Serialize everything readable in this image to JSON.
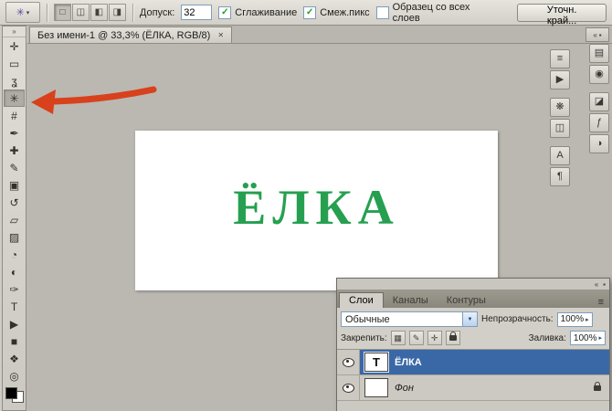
{
  "colors": {
    "artwork_green": "#26a050",
    "arrow_red": "#d8411c",
    "selected_layer_blue": "#3a68a6"
  },
  "icons": {
    "close": "✕",
    "chevron_left": "«",
    "chevron_right": "»",
    "caret_down": "▾",
    "dropdown_arrow": "▼",
    "spinner_arrow": "▸",
    "check": "✓",
    "menu": "≡",
    "panel_box": "▪"
  },
  "options_bar": {
    "tool_preset_icon": "✳",
    "selection_modes": [
      {
        "name": "new-selection",
        "glyph": "□"
      },
      {
        "name": "add-to-selection",
        "glyph": "◫"
      },
      {
        "name": "subtract-from-selection",
        "glyph": "◧"
      },
      {
        "name": "intersect-selection",
        "glyph": "◨"
      }
    ],
    "tolerance_label": "Допуск:",
    "tolerance_value": "32",
    "checkboxes": [
      {
        "label": "Сглаживание",
        "checked": true
      },
      {
        "label": "Смеж.пикс",
        "checked": true
      },
      {
        "label": "Образец со всех слоев",
        "checked": false
      }
    ],
    "refine_edge_button": "Уточн. край..."
  },
  "tab_bar": {
    "document_title": "Без имени-1 @ 33,3% (ЁЛКА, RGB/8)"
  },
  "toolbar": {
    "tools": [
      {
        "name": "move",
        "glyph": "✛"
      },
      {
        "name": "rectangular-marquee",
        "glyph": "▭"
      },
      {
        "name": "lasso",
        "glyph": "ʓ"
      },
      {
        "name": "magic-wand",
        "glyph": "✳",
        "active": true
      },
      {
        "name": "crop",
        "glyph": "#"
      },
      {
        "name": "eyedropper",
        "glyph": "✒"
      },
      {
        "name": "healing-brush",
        "glyph": "✚"
      },
      {
        "name": "brush",
        "glyph": "✎"
      },
      {
        "name": "clone-stamp",
        "glyph": "▣"
      },
      {
        "name": "history-brush",
        "glyph": "↺"
      },
      {
        "name": "eraser",
        "glyph": "▱"
      },
      {
        "name": "gradient",
        "glyph": "▨"
      },
      {
        "name": "blur",
        "glyph": "◔"
      },
      {
        "name": "dodge",
        "glyph": "◐"
      },
      {
        "name": "pen",
        "glyph": "✑"
      },
      {
        "name": "type",
        "glyph": "T"
      },
      {
        "name": "path-selection",
        "glyph": "▶"
      },
      {
        "name": "shape",
        "glyph": "■"
      },
      {
        "name": "hand",
        "glyph": "❖"
      },
      {
        "name": "zoom",
        "glyph": "◎"
      }
    ]
  },
  "canvas": {
    "artwork_text": "ЁЛКА"
  },
  "right_dock": {
    "inner_column": [
      {
        "name": "adjustments",
        "glyph": "≡"
      },
      {
        "name": "actions",
        "glyph": "▶"
      },
      {
        "name": "brushes",
        "glyph": "❋"
      },
      {
        "name": "clone-source",
        "glyph": "◫"
      },
      {
        "name": "character",
        "glyph": "A"
      },
      {
        "name": "paragraph",
        "glyph": "¶"
      }
    ],
    "outer_column": [
      {
        "name": "histogram",
        "glyph": "▤"
      },
      {
        "name": "navigator",
        "glyph": "◉"
      },
      {
        "name": "color",
        "glyph": "◪"
      },
      {
        "name": "styles",
        "glyph": "ƒ"
      },
      {
        "name": "masks",
        "glyph": "◑"
      }
    ]
  },
  "layers_panel": {
    "tabs": [
      {
        "label": "Слои",
        "active": true
      },
      {
        "label": "Каналы",
        "active": false
      },
      {
        "label": "Контуры",
        "active": false
      }
    ],
    "blend_mode_value": "Обычные",
    "opacity_label": "Непрозрачность:",
    "opacity_value": "100%",
    "lock_label": "Закрепить:",
    "lock_buttons": [
      {
        "name": "lock-transparency",
        "glyph": "▦"
      },
      {
        "name": "lock-pixels",
        "glyph": "✎"
      },
      {
        "name": "lock-position",
        "glyph": "✛"
      }
    ],
    "fill_label": "Заливка:",
    "fill_value": "100%",
    "layers": [
      {
        "name": "ЁЛКА",
        "thumb_glyph": "T",
        "selected": true
      },
      {
        "name": "Фон",
        "thumb_glyph": "",
        "selected": false,
        "locked": true
      }
    ]
  }
}
